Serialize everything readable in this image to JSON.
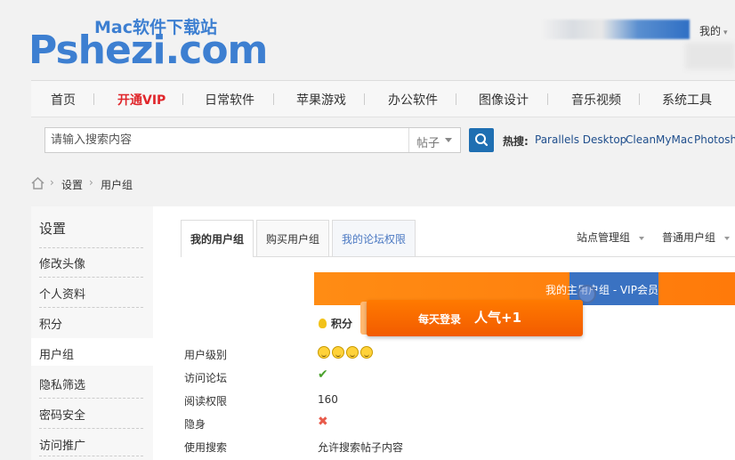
{
  "header": {
    "logo_sub": "Mac软件下载站",
    "logo_main": "Pshezi.com",
    "user_menu": "我的"
  },
  "nav": {
    "items": [
      {
        "label": "首页"
      },
      {
        "label": "开通VIP"
      },
      {
        "label": "日常软件"
      },
      {
        "label": "苹果游戏"
      },
      {
        "label": "办公软件"
      },
      {
        "label": "图像设计"
      },
      {
        "label": "音乐视频"
      },
      {
        "label": "系统工具"
      }
    ]
  },
  "search": {
    "placeholder": "请输入搜索内容",
    "type": "帖子",
    "hot_label": "热搜:",
    "hot_links": [
      "Parallels Desktop",
      "CleanMyMac",
      "Photoshop"
    ]
  },
  "breadcrumb": [
    "设置",
    "用户组"
  ],
  "sidebar": {
    "title": "设置",
    "items": [
      {
        "label": "修改头像"
      },
      {
        "label": "个人资料"
      },
      {
        "label": "积分"
      },
      {
        "label": "用户组"
      },
      {
        "label": "隐私筛选"
      },
      {
        "label": "密码安全"
      },
      {
        "label": "访问推广"
      }
    ]
  },
  "tabs": [
    {
      "label": "我的用户组"
    },
    {
      "label": "购买用户组"
    },
    {
      "label": "我的论坛权限"
    }
  ],
  "group_selects": [
    {
      "label": "站点管理组"
    },
    {
      "label": "普通用户组"
    }
  ],
  "main_group": {
    "title": "我的主用户组 - VIP会员"
  },
  "points_label": "积分",
  "popup": {
    "text1": "每天登录",
    "text2": "人气+1"
  },
  "rows": [
    {
      "label": "用户级别",
      "value": ""
    },
    {
      "label": "访问论坛",
      "value": "✔"
    },
    {
      "label": "阅读权限",
      "value": "160"
    },
    {
      "label": "隐身",
      "value": "✖"
    },
    {
      "label": "使用搜索",
      "value": "允许搜索帖子内容"
    }
  ],
  "colors": {
    "brand_blue": "#3d7fd1",
    "vip_red": "#e0262b",
    "orange": "#ff8c14",
    "search_button": "#1f6fb2"
  }
}
